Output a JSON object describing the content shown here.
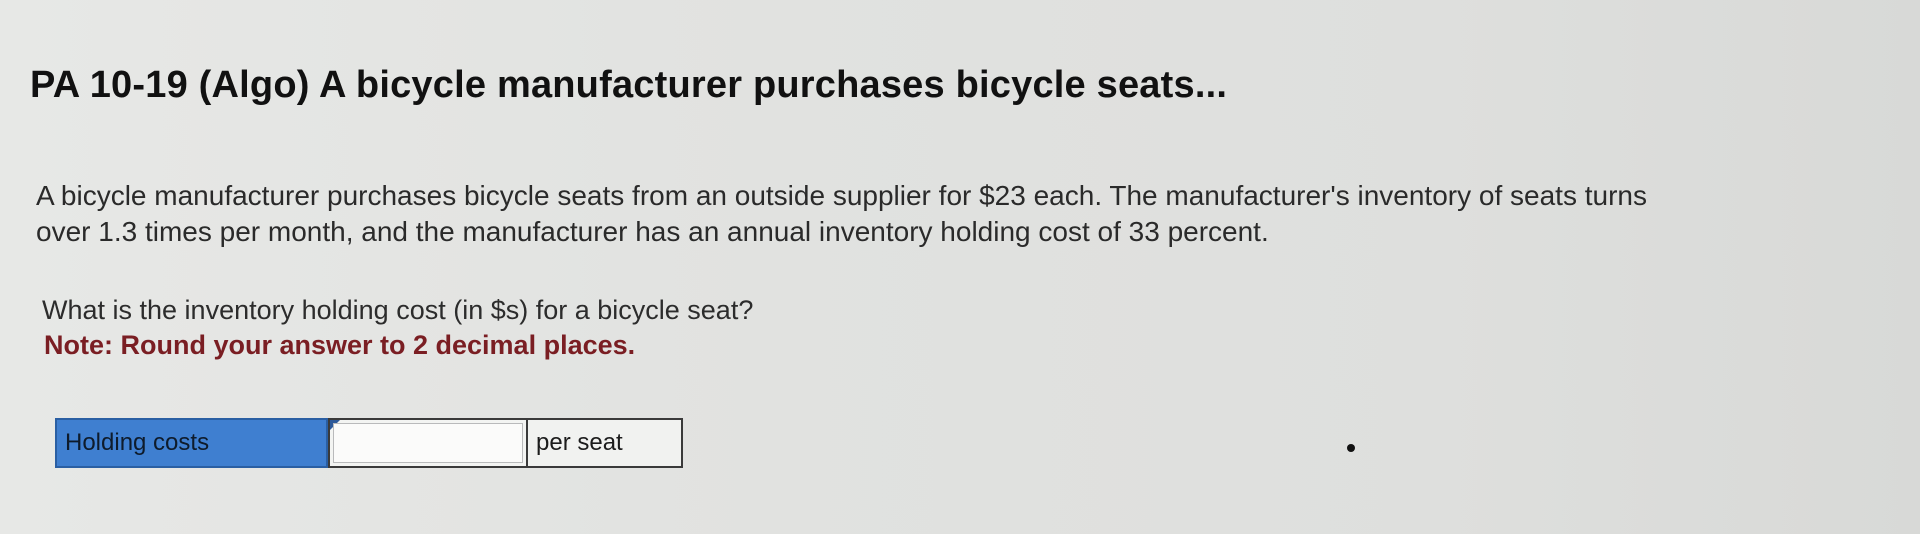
{
  "header": {
    "title": "PA 10-19 (Algo) A bicycle manufacturer purchases bicycle seats..."
  },
  "problem": {
    "body_line1": "A bicycle manufacturer purchases bicycle seats from an outside supplier for $23 each. The manufacturer's inventory of seats turns",
    "body_line2": "over 1.3 times per month, and the manufacturer has an annual inventory holding cost of 33 percent.",
    "question": "What is the inventory holding cost (in $s) for a bicycle seat?",
    "note": "Note: Round your answer to 2 decimal places."
  },
  "answer": {
    "label": "Holding costs",
    "value": "",
    "unit": "per seat"
  },
  "colors": {
    "label_bg": "#3f7fd0",
    "note_text": "#7a1e23"
  }
}
